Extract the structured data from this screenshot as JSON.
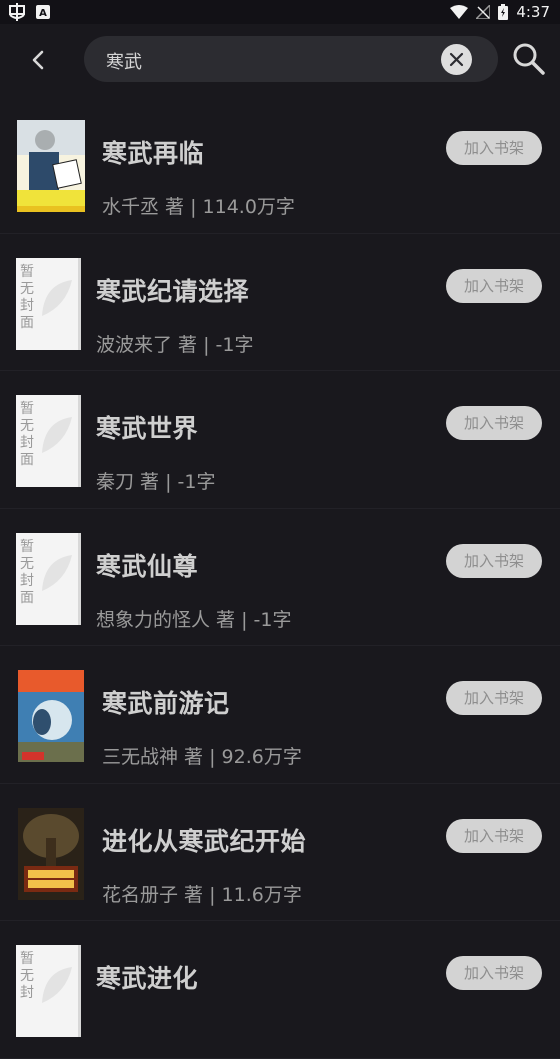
{
  "status_bar": {
    "time": "4:37"
  },
  "search": {
    "query": "寒武"
  },
  "books": [
    {
      "title": "寒武再临",
      "author": "水千丞",
      "author_suffix": "著",
      "word_count": "114.0万字",
      "meta": "水千丞 著 | 114.0万字",
      "has_cover": true,
      "button": "加入书架"
    },
    {
      "title": "寒武纪请选择",
      "author": "波波来了",
      "author_suffix": "著",
      "word_count": "-1字",
      "meta": "波波来了 著 | -1字",
      "has_cover": false,
      "no_cover_text": "暂无封面",
      "button": "加入书架"
    },
    {
      "title": "寒武世界",
      "author": "秦刀",
      "author_suffix": "著",
      "word_count": "-1字",
      "meta": "秦刀 著 | -1字",
      "has_cover": false,
      "no_cover_text": "暂无封面",
      "button": "加入书架"
    },
    {
      "title": "寒武仙尊",
      "author": "想象力的怪人",
      "author_suffix": "著",
      "word_count": "-1字",
      "meta": "想象力的怪人 著 | -1字",
      "has_cover": false,
      "no_cover_text": "暂无封面",
      "button": "加入书架"
    },
    {
      "title": "寒武前游记",
      "author": "三无战神",
      "author_suffix": "著",
      "word_count": "92.6万字",
      "meta": "三无战神 著 | 92.6万字",
      "has_cover": true,
      "button": "加入书架"
    },
    {
      "title": "进化从寒武纪开始",
      "author": "花名册子",
      "author_suffix": "著",
      "word_count": "11.6万字",
      "meta": "花名册子 著 | 11.6万字",
      "has_cover": true,
      "button": "加入书架"
    },
    {
      "title": "寒武进化",
      "has_cover": false,
      "no_cover_text": "暂无封",
      "button": "加入书架"
    }
  ]
}
